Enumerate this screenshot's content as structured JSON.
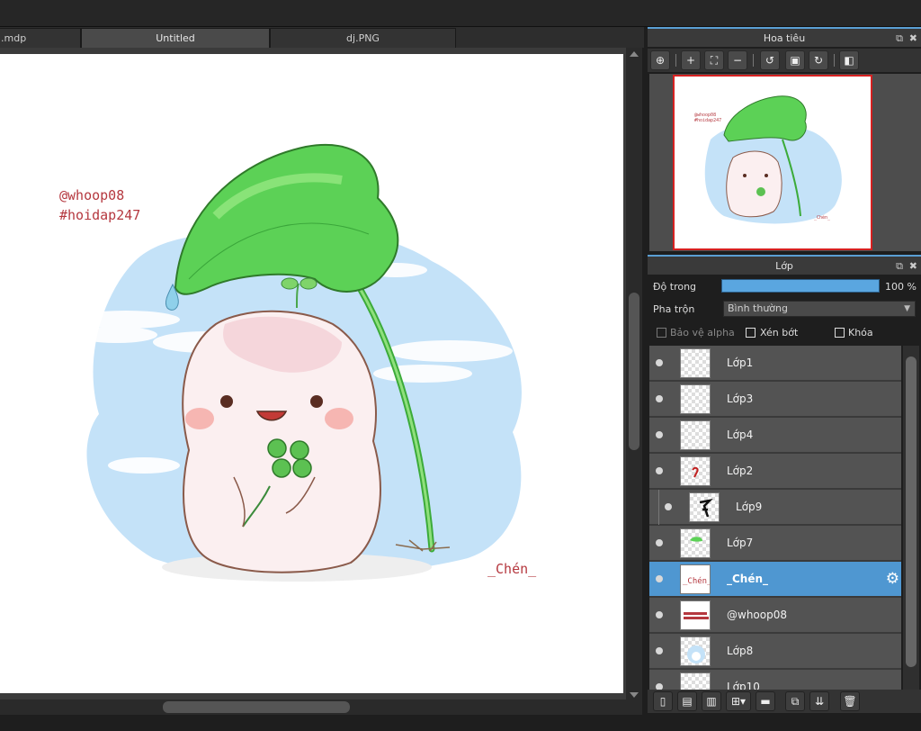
{
  "tabs": [
    {
      "label": ".mdp",
      "active": false
    },
    {
      "label": "Untitled",
      "active": true
    },
    {
      "label": "dj.PNG",
      "active": false
    }
  ],
  "canvas": {
    "watermark_line1": "@whoop08",
    "watermark_line2": "#hoidap247",
    "signature": "_Chén_"
  },
  "navigator": {
    "title": "Hoa tiêu",
    "toolbar": [
      "zoom-actual-icon",
      "zoom-in-icon",
      "fit-icon",
      "zoom-out-icon",
      "rotate-left-icon",
      "fullscreen-icon",
      "rotate-right-icon",
      "flip-icon"
    ],
    "thumb_text1": "@whoop08",
    "thumb_text2": "#hoidap247",
    "thumb_sig": "_Chén_"
  },
  "layers_panel": {
    "title": "Lớp",
    "opacity_label": "Độ trong",
    "opacity_value": "100 %",
    "opacity_fraction": 1.0,
    "blend_label": "Pha trộn",
    "blend_value": "Bình thường",
    "protect_alpha": "Bảo vệ alpha",
    "clipping": "Xén bớt",
    "lock": "Khóa",
    "layers": [
      {
        "name": "Lớp1",
        "selected": false
      },
      {
        "name": "Lớp3",
        "selected": false
      },
      {
        "name": "Lớp4",
        "selected": false
      },
      {
        "name": "Lớp2",
        "selected": false
      },
      {
        "name": "Lớp9",
        "selected": false,
        "clipped": true
      },
      {
        "name": "Lớp7",
        "selected": false
      },
      {
        "name": "_Chén_",
        "selected": true
      },
      {
        "name": "@whoop08",
        "selected": false
      },
      {
        "name": "Lớp8",
        "selected": false
      },
      {
        "name": "Lớp10",
        "selected": false
      }
    ]
  },
  "colors": {
    "accent": "#4f97d1",
    "leaf": "#5fd35a",
    "sky": "#bfe0f8",
    "body": "#f7e1e3"
  }
}
